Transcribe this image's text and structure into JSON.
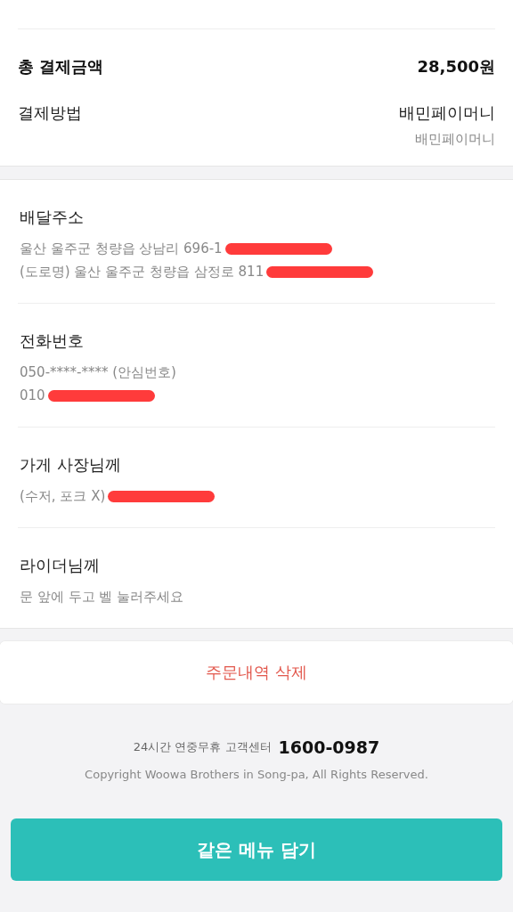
{
  "payment": {
    "rows": [
      {
        "kind": "total",
        "label": "총 결제금액",
        "value": "28,500원"
      },
      {
        "kind": "method",
        "label": "결제방법",
        "value": "배민페이머니",
        "sub": "배민페이머니"
      }
    ]
  },
  "details": [
    {
      "title": "배달주소",
      "lines": [
        {
          "text": "울산 울주군 청량읍 상남리 696-1",
          "redacted": true
        },
        {
          "text": "(도로명) 울산 울주군 청량읍 삼정로 811",
          "redacted": true
        }
      ]
    },
    {
      "title": "전화번호",
      "lines": [
        {
          "text": "050-****-**** (안심번호)",
          "redacted": false
        },
        {
          "text": "010",
          "redacted": true
        }
      ]
    },
    {
      "title": "가게 사장님께",
      "lines": [
        {
          "text": "(수저, 포크 X)",
          "redacted": true
        }
      ]
    },
    {
      "title": "라이더님께",
      "lines": [
        {
          "text": "문 앞에 두고 벨 눌러주세요",
          "redacted": false
        }
      ]
    }
  ],
  "delete_button": "주문내역 삭제",
  "footer": {
    "support_label": "24시간 연중무휴 고객센터",
    "support_phone": "1600-0987",
    "copyright": "Copyright Woowa Brothers in Song-pa, All Rights Reserved."
  },
  "reorder_button": "같은 메뉴 담기"
}
